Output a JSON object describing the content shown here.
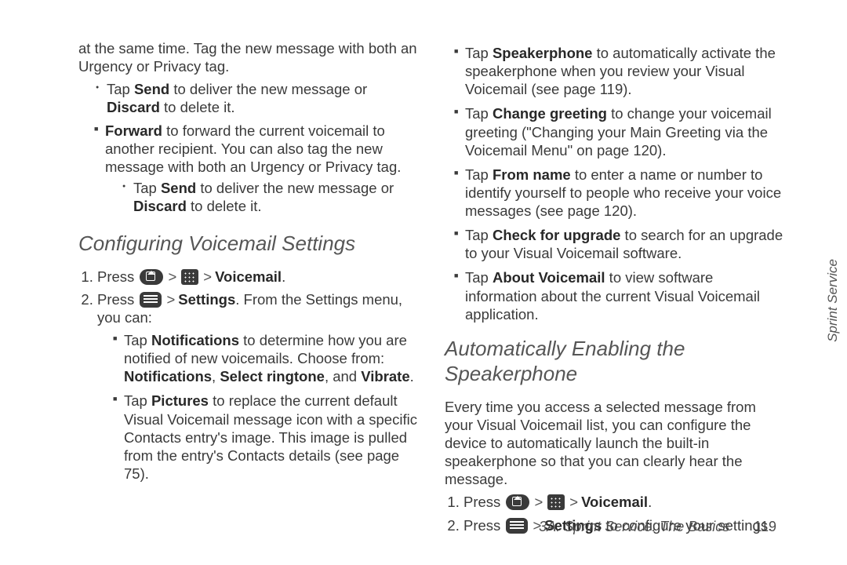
{
  "left": {
    "intro": "at the same time. Tag the new message with both an Urgency or Privacy tag.",
    "send_bullet_pre": "Tap ",
    "send_bullet_b1": "Send",
    "send_bullet_mid": " to deliver the new message or ",
    "send_bullet_b2": "Discard",
    "send_bullet_end": " to delete it.",
    "forward_b": "Forward",
    "forward_text": " to forward the current voicemail to another recipient. You can also tag the new message with both an Urgency or Privacy tag.",
    "heading": "Configuring Voicemail Settings",
    "step1_pre": "Press ",
    "step1_end": "Voicemail",
    "step1_dot": ".",
    "step2_pre": "Press ",
    "step2_b": "Settings",
    "step2_end": ". From the Settings menu, you can:",
    "notif_pre": "Tap ",
    "notif_b": "Notifications",
    "notif_mid": " to determine how you are notified of new voicemails. Choose from: ",
    "notif_b2": "Notifications",
    "notif_comma": ", ",
    "notif_b3": "Select ringtone",
    "notif_and": ", and ",
    "notif_b4": "Vibrate",
    "notif_dot": ".",
    "pic_pre": "Tap ",
    "pic_b": "Pictures",
    "pic_text": " to replace the current default Visual Voicemail message icon with a specific Contacts entry's image. This image is pulled from the entry's Contacts details (see page 75)."
  },
  "right": {
    "spk_pre": "Tap ",
    "spk_b": "Speakerphone",
    "spk_text": " to automatically activate the speakerphone when you review your Visual Voicemail (see page 119).",
    "chg_pre": "Tap ",
    "chg_b": "Change greeting",
    "chg_text": " to change your voicemail greeting (\"Changing your Main Greeting via the Voicemail Menu\" on page 120).",
    "from_pre": "Tap ",
    "from_b": "From name",
    "from_text": " to enter a name or number to identify yourself to people who receive your voice messages (see page 120).",
    "upg_pre": "Tap ",
    "upg_b": "Check for upgrade",
    "upg_text": " to search for an upgrade to your Visual Voicemail software.",
    "about_pre": "Tap ",
    "about_b": "About Voicemail",
    "about_text": " to view software information about the current Visual Voicemail application.",
    "heading": "Automatically Enabling the Speakerphone",
    "intro": "Every time you access a selected message from your Visual Voicemail list, you can configure the device to automatically launch the built-in speakerphone so that you can clearly hear the message.",
    "step1_pre": "Press ",
    "step1_end": "Voicemail",
    "step1_dot": ".",
    "step2_pre": "Press ",
    "step2_b": "Settings",
    "step2_end": " to configure your settings."
  },
  "footer": {
    "section": "3A. Sprint Service: The Basics",
    "page": "119"
  },
  "sidetab": "Sprint Service"
}
